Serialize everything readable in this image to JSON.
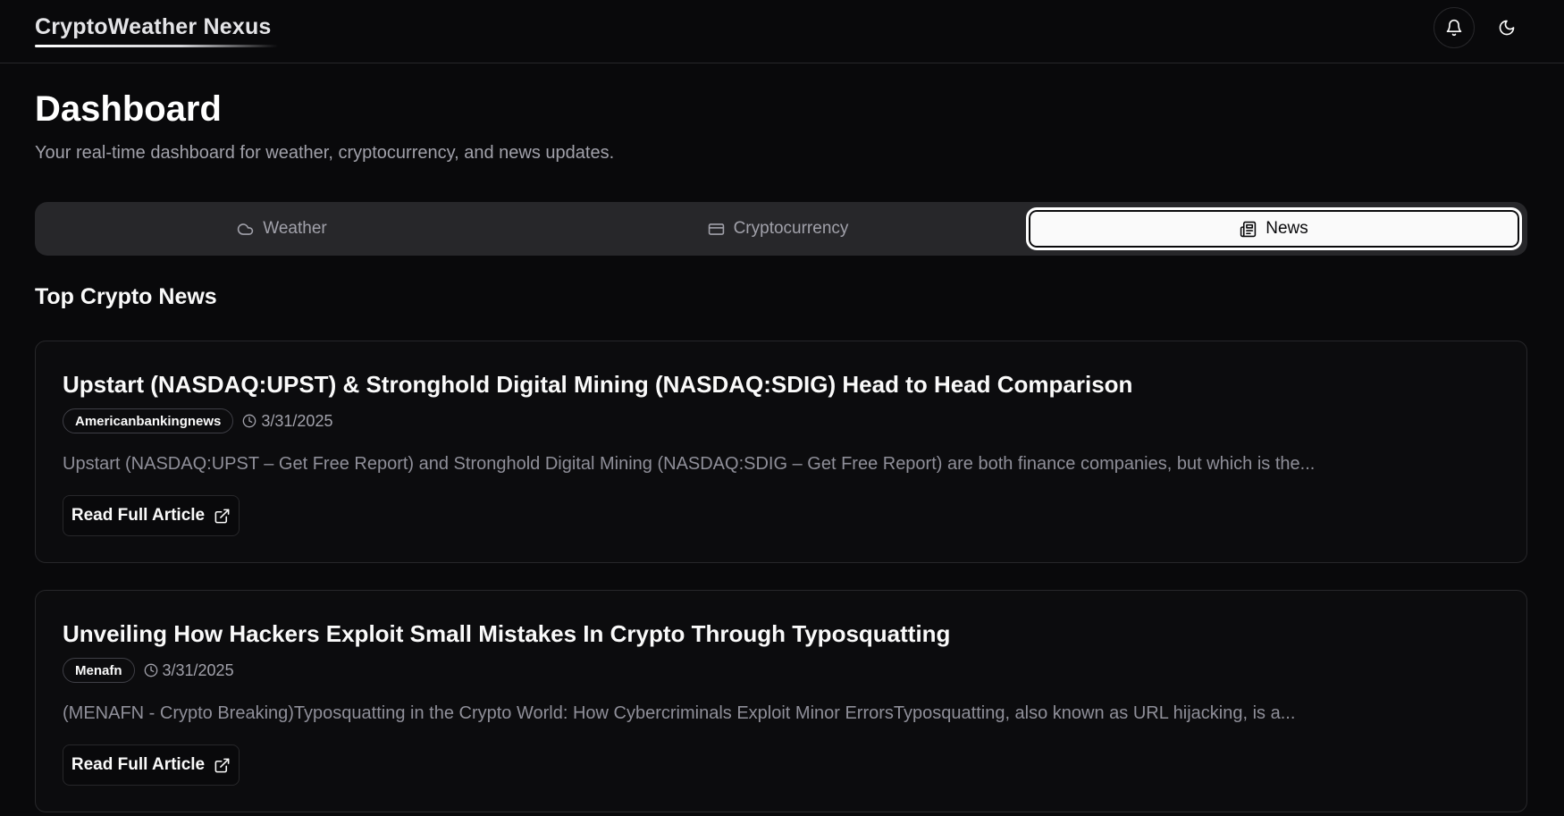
{
  "header": {
    "brand": "CryptoWeather Nexus",
    "icons": [
      "bell-icon",
      "moon-icon"
    ]
  },
  "page": {
    "title": "Dashboard",
    "subtitle": "Your real-time dashboard for weather, cryptocurrency, and news updates."
  },
  "tabs": [
    {
      "label": "Weather",
      "icon": "cloud-icon",
      "active": false
    },
    {
      "label": "Cryptocurrency",
      "icon": "card-icon",
      "active": false
    },
    {
      "label": "News",
      "icon": "newspaper-icon",
      "active": true
    }
  ],
  "news": {
    "section_title": "Top Crypto News",
    "articles": [
      {
        "title": "Upstart (NASDAQ:UPST) & Stronghold Digital Mining (NASDAQ:SDIG) Head to Head Comparison",
        "source": "Americanbankingnews",
        "date": "3/31/2025",
        "excerpt": "Upstart (NASDAQ:UPST – Get Free Report) and Stronghold Digital Mining (NASDAQ:SDIG – Get Free Report) are both finance companies, but which is the...",
        "button_label": "Read Full Article"
      },
      {
        "title": "Unveiling How Hackers Exploit Small Mistakes In Crypto Through Typosquatting",
        "source": "Menafn",
        "date": "3/31/2025",
        "excerpt": "(MENAFN - Crypto Breaking)Typosquatting in the Crypto World: How Cybercriminals Exploit Minor ErrorsTyposquatting, also known as URL hijacking, is a...",
        "button_label": "Read Full Article"
      }
    ]
  },
  "colors": {
    "background": "#09090b",
    "border": "#27272a",
    "muted_text": "#a1a1aa",
    "active_tab": "#fafafa"
  }
}
